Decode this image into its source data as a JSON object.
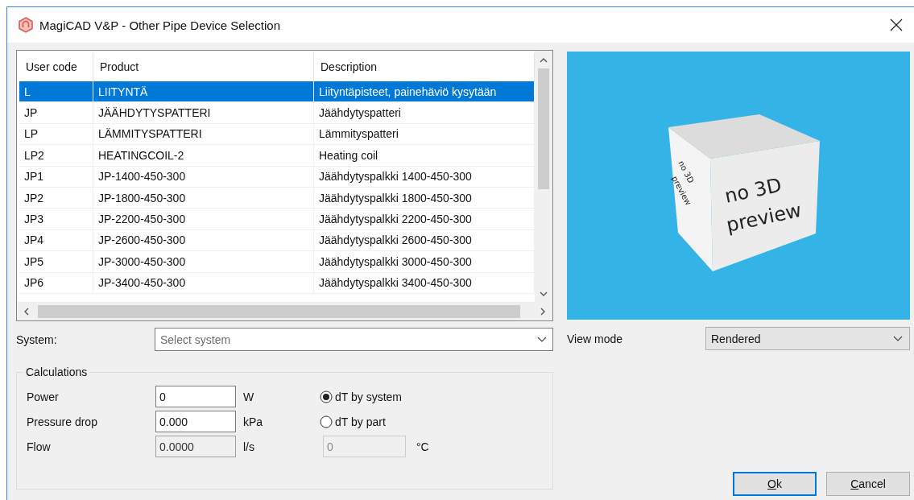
{
  "window": {
    "title": "MagiCAD V&P - Other Pipe Device Selection"
  },
  "table": {
    "columns": [
      "User code",
      "Product",
      "Description"
    ],
    "rows": [
      {
        "cells": [
          "L",
          "LIITYNTÄ",
          "Liityntäpisteet, painehäviö kysytään"
        ],
        "selected": true
      },
      {
        "cells": [
          "JP",
          "JÄÄHDYTYSPATTERI",
          "Jäähdytyspatteri"
        ],
        "selected": false
      },
      {
        "cells": [
          "LP",
          "LÄMMITYSPATTERI",
          "Lämmityspatteri"
        ],
        "selected": false
      },
      {
        "cells": [
          "LP2",
          "HEATINGCOIL-2",
          "Heating coil"
        ],
        "selected": false
      },
      {
        "cells": [
          "JP1",
          "JP-1400-450-300",
          "Jäähdytyspalkki 1400-450-300"
        ],
        "selected": false
      },
      {
        "cells": [
          "JP2",
          "JP-1800-450-300",
          "Jäähdytyspalkki 1800-450-300"
        ],
        "selected": false
      },
      {
        "cells": [
          "JP3",
          "JP-2200-450-300",
          "Jäähdytyspalkki 2200-450-300"
        ],
        "selected": false
      },
      {
        "cells": [
          "JP4",
          "JP-2600-450-300",
          "Jäähdytyspalkki 2600-450-300"
        ],
        "selected": false
      },
      {
        "cells": [
          "JP5",
          "JP-3000-450-300",
          "Jäähdytyspalkki 3000-450-300"
        ],
        "selected": false
      },
      {
        "cells": [
          "JP6",
          "JP-3400-450-300",
          "Jäähdytyspalkki 3400-450-300"
        ],
        "selected": false
      }
    ]
  },
  "preview": {
    "front_text": "no 3D preview",
    "side_text": "no 3D preview"
  },
  "system": {
    "label": "System:",
    "placeholder": "Select system"
  },
  "view_mode": {
    "label": "View mode",
    "value": "Rendered"
  },
  "calculations": {
    "title": "Calculations",
    "fields": [
      {
        "label": "Power",
        "value": "0",
        "unit": "W",
        "disabled": false
      },
      {
        "label": "Pressure drop",
        "value": "0.000",
        "unit": "kPa",
        "disabled": false
      },
      {
        "label": "Flow",
        "value": "0.0000",
        "unit": "l/s",
        "disabled": true
      }
    ],
    "radios": [
      {
        "label": "dT by system",
        "selected": true
      },
      {
        "label": "dT by part",
        "selected": false
      }
    ],
    "dt_field": {
      "value": "0",
      "unit": "°C",
      "disabled": true
    }
  },
  "buttons": [
    {
      "key": "O",
      "rest": "k",
      "default": true
    },
    {
      "key": "C",
      "rest": "ancel",
      "default": false
    }
  ]
}
